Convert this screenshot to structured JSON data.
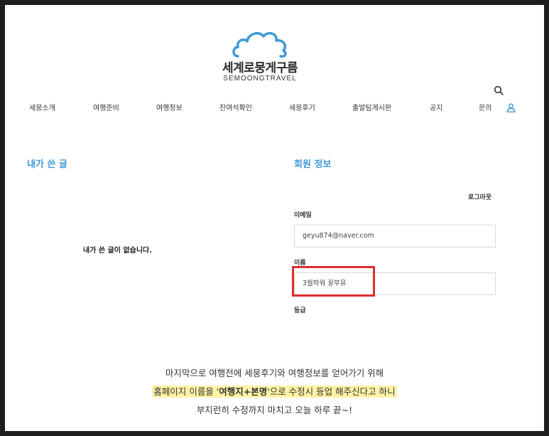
{
  "logo": {
    "korean_name": "세계로뭉게구름",
    "english_name": "SEMOONGTRAVEL",
    "colors": {
      "cloud": "#3d9ad6",
      "accent": "#ef8a3c"
    }
  },
  "header": {
    "search_icon": "search-icon",
    "user_icon": "user-icon"
  },
  "nav": {
    "items": [
      {
        "label": "세뭉소개"
      },
      {
        "label": "여행준비"
      },
      {
        "label": "여행정보"
      },
      {
        "label": "잔여석확인"
      },
      {
        "label": "세뭉후기"
      },
      {
        "label": "출발팀게시판"
      },
      {
        "label": "공지"
      },
      {
        "label": "문의"
      }
    ]
  },
  "my_posts": {
    "title": "내가 쓴 글",
    "empty_message": "내가 쓴 글이 없습니다."
  },
  "member_info": {
    "title": "회원 정보",
    "logout_label": "로그아웃",
    "email_label": "이메일",
    "email_value": "geyu874@naver.com",
    "name_label": "이름",
    "name_value": "3월파워 꿍부유",
    "grade_label": "등급"
  },
  "caption": {
    "line1": "마지막으로 여행전에 세뭉후기와 여행정보를 얻어가기 위해",
    "line2_prefix": "홈페이지 이름을 '",
    "line2_bold": "여행지+본명",
    "line2_suffix": "'으로 수정시 등업 해주신다고 하니",
    "line3": "부지런히 수정까지 마치고 오늘 하루 끝~!"
  },
  "colors": {
    "accent": "#3d9ad6",
    "highlight_border": "#e12d2d",
    "caption_highlight": "#fff3a6"
  }
}
